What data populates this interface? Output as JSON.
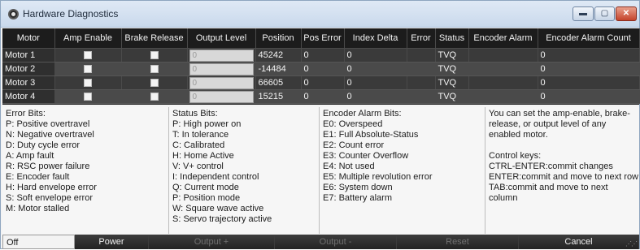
{
  "window": {
    "title": "Hardware Diagnostics",
    "controls": {
      "minimize": "▬",
      "maximize": "▢",
      "close": "✕"
    }
  },
  "grid": {
    "columns": [
      "Motor",
      "Amp Enable",
      "Brake Release",
      "Output Level",
      "Position",
      "Pos Error",
      "Index Delta",
      "Error",
      "Status",
      "Encoder Alarm",
      "Encoder Alarm Count"
    ],
    "rows": [
      {
        "motor": "Motor 1",
        "amp_enable": true,
        "brake_release": true,
        "output_level": "0",
        "position": "45242",
        "pos_error": "0",
        "index_delta": "0",
        "error": "",
        "status": "TVQ",
        "encoder_alarm": "",
        "encoder_alarm_count": "0"
      },
      {
        "motor": "Motor 2",
        "amp_enable": true,
        "brake_release": true,
        "output_level": "0",
        "position": "-14484",
        "pos_error": "0",
        "index_delta": "0",
        "error": "",
        "status": "TVQ",
        "encoder_alarm": "",
        "encoder_alarm_count": "0"
      },
      {
        "motor": "Motor 3",
        "amp_enable": true,
        "brake_release": true,
        "output_level": "0",
        "position": "66605",
        "pos_error": "0",
        "index_delta": "0",
        "error": "",
        "status": "TVQ",
        "encoder_alarm": "",
        "encoder_alarm_count": "0"
      },
      {
        "motor": "Motor 4",
        "amp_enable": true,
        "brake_release": true,
        "output_level": "0",
        "position": "15215",
        "pos_error": "0",
        "index_delta": "0",
        "error": "",
        "status": "TVQ",
        "encoder_alarm": "",
        "encoder_alarm_count": "0"
      }
    ]
  },
  "legend": {
    "error_bits": {
      "title": "Error Bits:",
      "items": [
        "P: Positive overtravel",
        "N: Negative overtravel",
        "D: Duty cycle error",
        "A: Amp fault",
        "R: RSC power failure",
        "E: Encoder fault",
        "H: Hard envelope error",
        "S: Soft envelope error",
        "M: Motor stalled"
      ]
    },
    "status_bits": {
      "title": "Status Bits:",
      "items": [
        "P: High power on",
        "T: In tolerance",
        "C: Calibrated",
        "H: Home Active",
        "V: V+ control",
        "I: Independent control",
        "Q: Current mode",
        "P: Position mode",
        "W: Square wave active",
        "S: Servo trajectory active"
      ]
    },
    "encoder_alarm_bits": {
      "title": "Encoder Alarm Bits:",
      "items": [
        "E0: Overspeed",
        "E1: Full Absolute-Status",
        "E2: Count error",
        "E3: Counter Overflow",
        "E4: Not used",
        "E5: Multiple revolution error",
        "E6: System down",
        "E7: Battery alarm"
      ]
    },
    "help": {
      "lines": [
        "You can set the amp-enable, brake-",
        "release, or output level of any",
        "enabled motor."
      ],
      "keys_title": "Control keys:",
      "keys": [
        "CTRL-ENTER:commit changes",
        "ENTER:commit and move to next row",
        "TAB:commit and move to next",
        "column"
      ]
    }
  },
  "bottom_bar": {
    "off": "Off",
    "power": "Power",
    "output_plus": "Output +",
    "output_minus": "Output -",
    "reset": "Reset",
    "cancel": "Cancel"
  }
}
